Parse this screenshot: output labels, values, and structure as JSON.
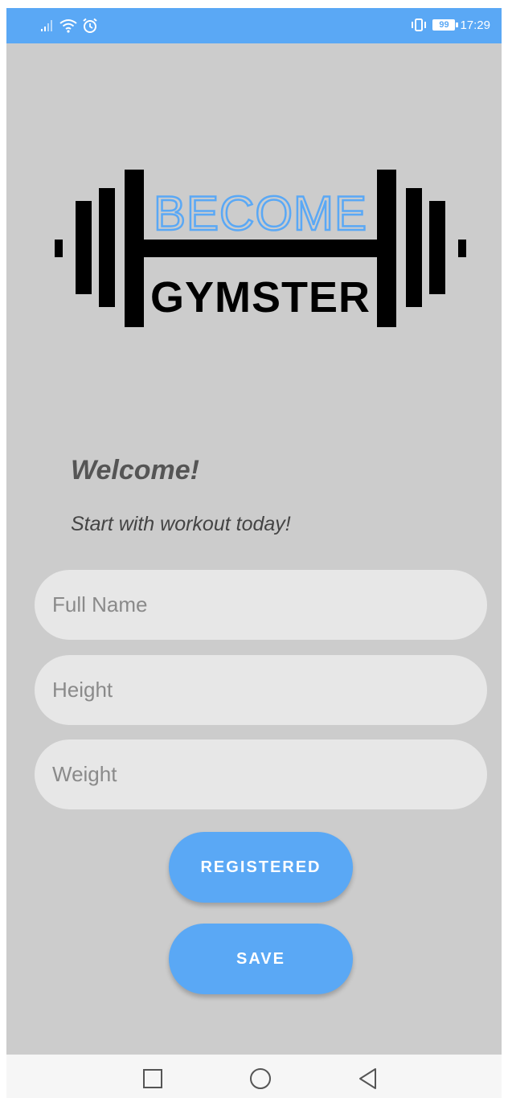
{
  "status_bar": {
    "time": "17:29",
    "battery": "99",
    "icons": [
      "signal-icon",
      "wifi-icon",
      "alarm-icon",
      "vibrate-icon",
      "battery-icon"
    ]
  },
  "logo": {
    "line1": "BECOME",
    "line2": "GYMSTER",
    "line1_color": "#5aa8f5",
    "line2_color": "#000000"
  },
  "welcome": {
    "title": "Welcome!",
    "subtitle": "Start with workout today!"
  },
  "form": {
    "full_name": {
      "placeholder": "Full Name",
      "value": ""
    },
    "height": {
      "placeholder": "Height",
      "value": ""
    },
    "weight": {
      "placeholder": "Weight",
      "value": ""
    }
  },
  "buttons": {
    "registered": "REGISTERED",
    "save": "SAVE"
  },
  "nav": {
    "icons": [
      "recent-apps-icon",
      "home-icon",
      "back-icon"
    ]
  },
  "colors": {
    "accent": "#5aa8f5",
    "background": "#cccccc",
    "field": "#e7e7e7",
    "nav_bar": "#f6f6f6"
  }
}
